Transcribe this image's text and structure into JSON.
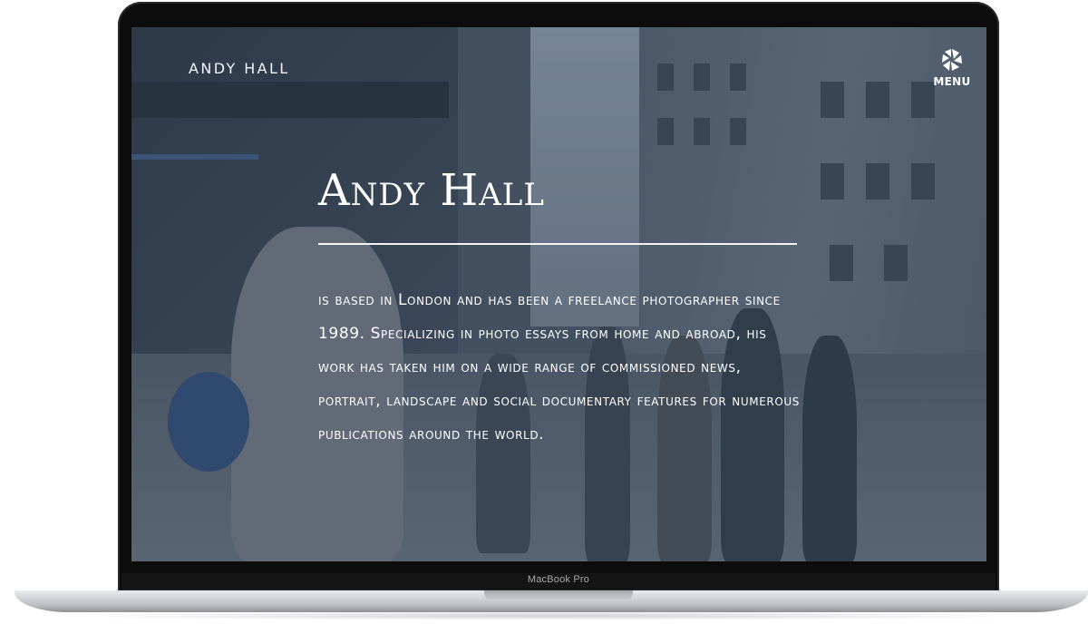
{
  "site": {
    "brand": "ANDY HALL",
    "menu_label": "MENU"
  },
  "hero": {
    "title": "Andy Hall",
    "bio": "is based in London and has been a freelance photographer since 1989. Specializing in photo essays from home and abroad, his work has taken him on a wide range of commissioned news, portrait, landscape and social documentary features for numerous publications around the world."
  },
  "device": {
    "label": "MacBook Pro"
  },
  "icons": {
    "menu": "aperture-icon"
  }
}
